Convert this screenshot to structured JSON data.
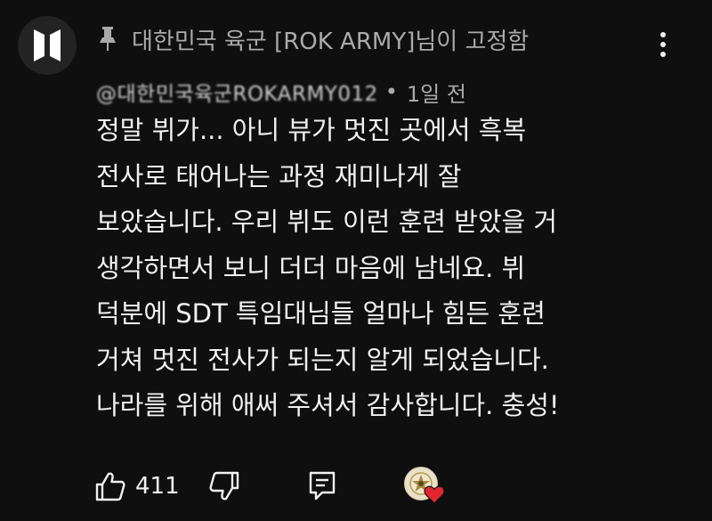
{
  "comment": {
    "pinned_label": "대한민국 육군 [ROK ARMY]님이 고정함",
    "author_handle": "@대한민국육군ROKARMY012",
    "separator": "•",
    "timestamp": "1일 전",
    "lines": [
      "정말 뷔가... 아니 뷰가 멋진 곳에서 흑복",
      "전사로 태어나는 과정 재미나게 잘",
      "보았습니다. 우리 뷔도 이런 훈련 받았을 거",
      "생각하면서 보니 더더 마음에 남네요. 뷔",
      "덕분에 SDT 특임대님들 얼마나 힘든 훈련",
      "거쳐 멋진 전사가 되는지 알게 되었습니다.",
      "나라를 위해 애써 주셔서 감사합니다. 충성!"
    ]
  },
  "actions": {
    "like_count": "411"
  },
  "icons": {
    "avatar": "bts-logo-icon",
    "pin": "pin-icon",
    "more": "more-vertical-icon",
    "like": "thumbs-up-icon",
    "dislike": "thumbs-down-icon",
    "reply": "reply-icon",
    "creator_heart": "creator-heart-icon"
  },
  "colors": {
    "background": "#0f0f0f",
    "text_primary": "#f1f1f1",
    "text_secondary": "#aaaaaa",
    "avatar_bg": "#232323",
    "heart": "#e3262f"
  }
}
